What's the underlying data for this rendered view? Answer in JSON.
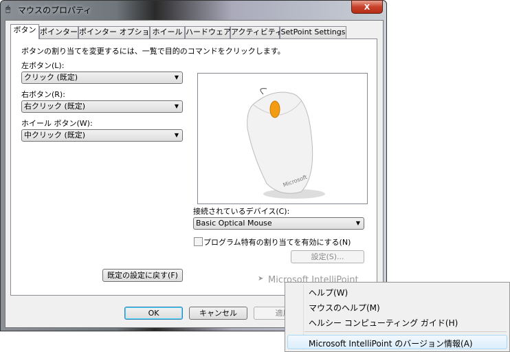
{
  "window": {
    "title": "マウスのプロパティ",
    "close_label": "X"
  },
  "tabs": [
    "ボタン",
    "ポインター",
    "ポインター オプション",
    "ホイール",
    "ハードウェア",
    "アクティビティ",
    "SetPoint Settings"
  ],
  "buttons_tab": {
    "description": "ボタンの割り当てを変更するには、一覧で目的のコマンドをクリックします。",
    "left_label": "左ボタン(L):",
    "left_value": "クリック (既定)",
    "right_label": "右ボタン(R):",
    "right_value": "右クリック (既定)",
    "wheel_label": "ホイール ボタン(W):",
    "wheel_value": "中クリック (既定)",
    "device_label": "接続されているデバイス(C):",
    "device_value": "Basic Optical Mouse",
    "program_checkbox": "プログラム特有の割り当てを有効にする(N)",
    "program_checked": false,
    "settings_button": "設定(S)...",
    "reset_button": "既定の設定に戻す(F)",
    "brand": "Microsoft IntelliPoint",
    "mouse_logo": "Microsoft"
  },
  "footer": {
    "ok": "OK",
    "cancel": "キャンセル",
    "apply": "適用"
  },
  "context_menu": {
    "items": [
      "ヘルプ(W)",
      "マウスのヘルプ(M)",
      "ヘルシー コンピューティング ガイド(H)",
      "Microsoft IntelliPoint のバージョン情報(A)"
    ]
  }
}
